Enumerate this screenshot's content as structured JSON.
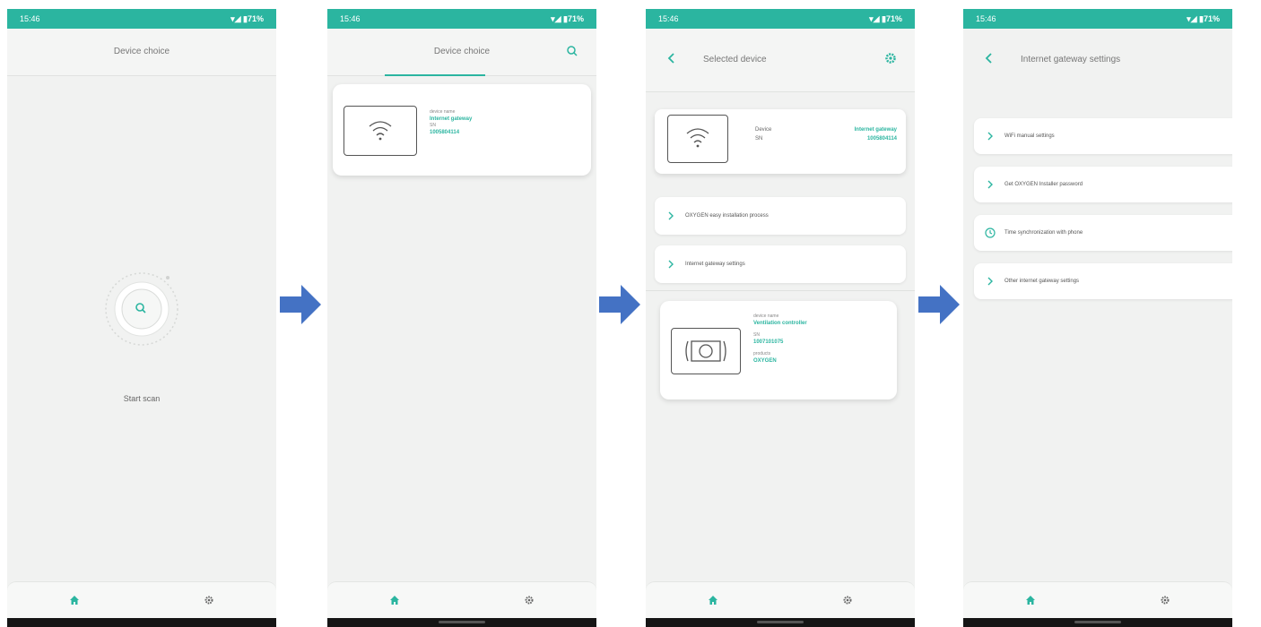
{
  "status": {
    "time": "15:46",
    "right": "▾◢ ▮71%"
  },
  "screen1": {
    "title": "Device choice",
    "scan_label": "Start scan"
  },
  "screen2": {
    "title": "Device choice",
    "device": {
      "name_label": "device name",
      "name": "Internet gateway",
      "sn_label": "SN",
      "sn": "1005804114"
    }
  },
  "screen3": {
    "title": "Selected device",
    "device": {
      "k1": "Device",
      "v1": "Internet gateway",
      "k2": "SN",
      "v2": "1005804114"
    },
    "menu": [
      "OXYGEN easy installation process",
      "Internet gateway settings"
    ],
    "controller": {
      "name_label": "device name",
      "name": "Ventilation controller",
      "sn_label": "SN",
      "sn": "1007101075",
      "product_label": "products",
      "product": "OXYGEN"
    }
  },
  "screen4": {
    "title": "Internet gateway settings",
    "menu": [
      {
        "icon": "chevron",
        "label": "WiFi manual settings"
      },
      {
        "icon": "chevron",
        "label": "Get OXYGEN Installer password"
      },
      {
        "icon": "clock",
        "label": "Time synchronization with phone"
      },
      {
        "icon": "chevron",
        "label": "Other internet gateway settings"
      }
    ]
  },
  "colors": {
    "accent": "#2bb5a0",
    "arrow": "#4472c4"
  }
}
